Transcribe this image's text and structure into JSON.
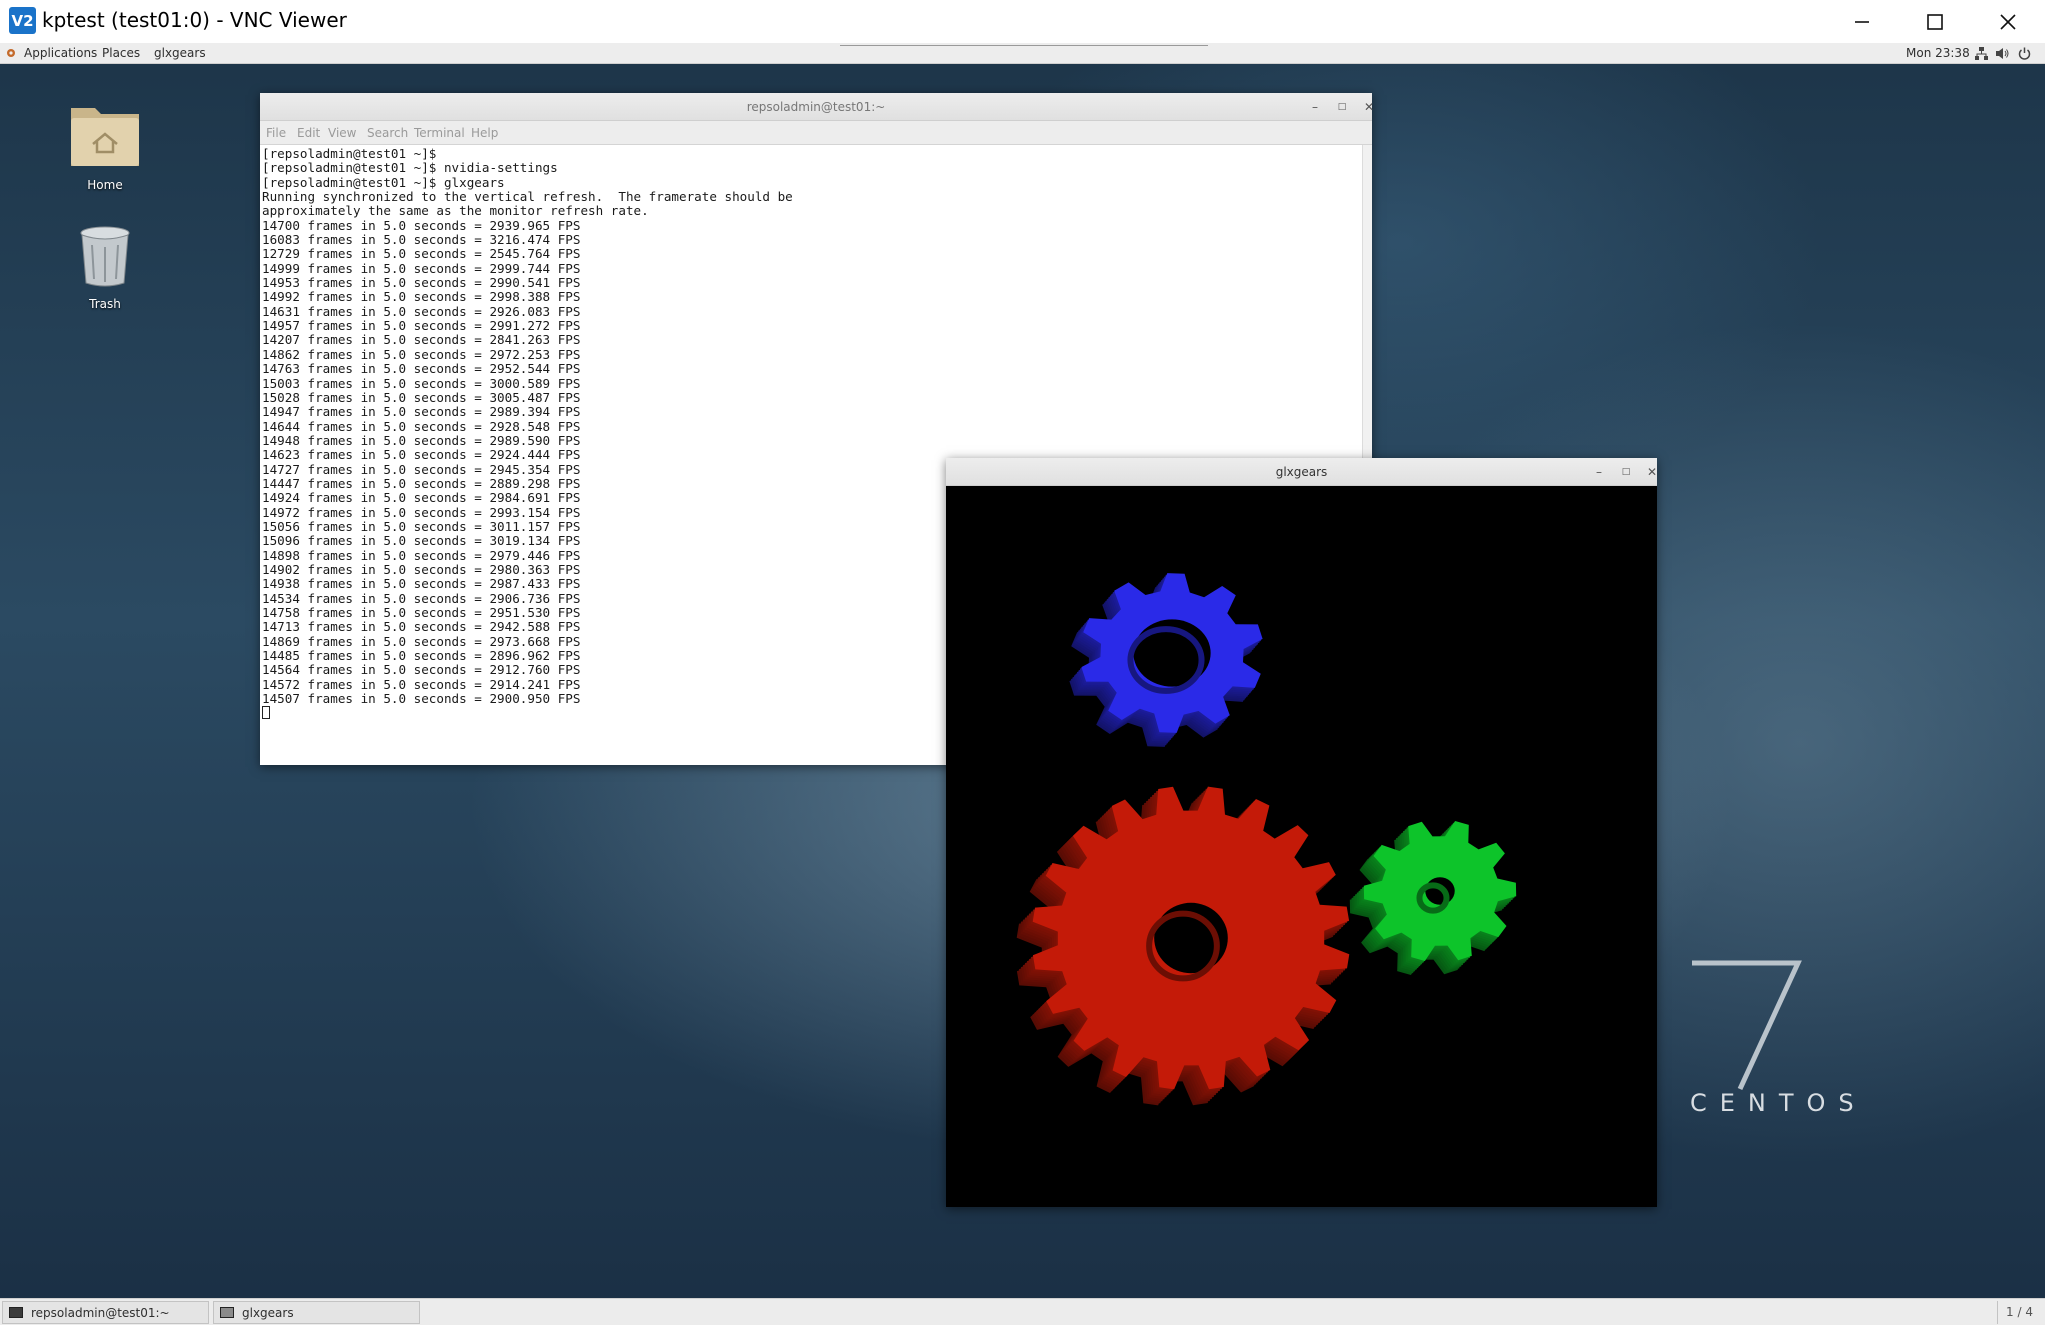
{
  "vnc": {
    "logo_text": "V2",
    "title": "kptest (test01:0) - VNC Viewer",
    "minimize_icon": "minimize-icon",
    "maximize_icon": "maximize-icon",
    "close_icon": "close-icon"
  },
  "top_panel": {
    "applications": "Applications",
    "places": "Places",
    "active_app": "glxgears",
    "clock": "Mon 23:38",
    "status_icons": [
      "network-icon",
      "volume-icon",
      "power-icon"
    ]
  },
  "desktop_icons": [
    {
      "label": "Home",
      "icon": "home-folder-icon"
    },
    {
      "label": "Trash",
      "icon": "trash-icon"
    }
  ],
  "terminal": {
    "title": "repsoladmin@test01:~",
    "menu": [
      "File",
      "Edit",
      "View",
      "Search",
      "Terminal",
      "Help"
    ],
    "lines": [
      "[repsoladmin@test01 ~]$",
      "[repsoladmin@test01 ~]$ nvidia-settings",
      "[repsoladmin@test01 ~]$ glxgears",
      "Running synchronized to the vertical refresh.  The framerate should be",
      "approximately the same as the monitor refresh rate.",
      "14700 frames in 5.0 seconds = 2939.965 FPS",
      "16083 frames in 5.0 seconds = 3216.474 FPS",
      "12729 frames in 5.0 seconds = 2545.764 FPS",
      "14999 frames in 5.0 seconds = 2999.744 FPS",
      "14953 frames in 5.0 seconds = 2990.541 FPS",
      "14992 frames in 5.0 seconds = 2998.388 FPS",
      "14631 frames in 5.0 seconds = 2926.083 FPS",
      "14957 frames in 5.0 seconds = 2991.272 FPS",
      "14207 frames in 5.0 seconds = 2841.263 FPS",
      "14862 frames in 5.0 seconds = 2972.253 FPS",
      "14763 frames in 5.0 seconds = 2952.544 FPS",
      "15003 frames in 5.0 seconds = 3000.589 FPS",
      "15028 frames in 5.0 seconds = 3005.487 FPS",
      "14947 frames in 5.0 seconds = 2989.394 FPS",
      "14644 frames in 5.0 seconds = 2928.548 FPS",
      "14948 frames in 5.0 seconds = 2989.590 FPS",
      "14623 frames in 5.0 seconds = 2924.444 FPS",
      "14727 frames in 5.0 seconds = 2945.354 FPS",
      "14447 frames in 5.0 seconds = 2889.298 FPS",
      "14924 frames in 5.0 seconds = 2984.691 FPS",
      "14972 frames in 5.0 seconds = 2993.154 FPS",
      "15056 frames in 5.0 seconds = 3011.157 FPS",
      "15096 frames in 5.0 seconds = 3019.134 FPS",
      "14898 frames in 5.0 seconds = 2979.446 FPS",
      "14902 frames in 5.0 seconds = 2980.363 FPS",
      "14938 frames in 5.0 seconds = 2987.433 FPS",
      "14534 frames in 5.0 seconds = 2906.736 FPS",
      "14758 frames in 5.0 seconds = 2951.530 FPS",
      "14713 frames in 5.0 seconds = 2942.588 FPS",
      "14869 frames in 5.0 seconds = 2973.668 FPS",
      "14485 frames in 5.0 seconds = 2896.962 FPS",
      "14564 frames in 5.0 seconds = 2912.760 FPS",
      "14572 frames in 5.0 seconds = 2914.241 FPS",
      "14507 frames in 5.0 seconds = 2900.950 FPS"
    ]
  },
  "glxgears": {
    "title": "glxgears",
    "gear_colors": {
      "red": "#c41a08",
      "green": "#0dc42a",
      "blue": "#2a2ae8"
    }
  },
  "branding": {
    "version": "7",
    "name": "CENTOS"
  },
  "taskbar": {
    "tasks": [
      {
        "label": "repsoladmin@test01:~",
        "icon": "terminal-icon"
      },
      {
        "label": "glxgears",
        "icon": "window-icon"
      }
    ],
    "workspace": "1 / 4"
  }
}
